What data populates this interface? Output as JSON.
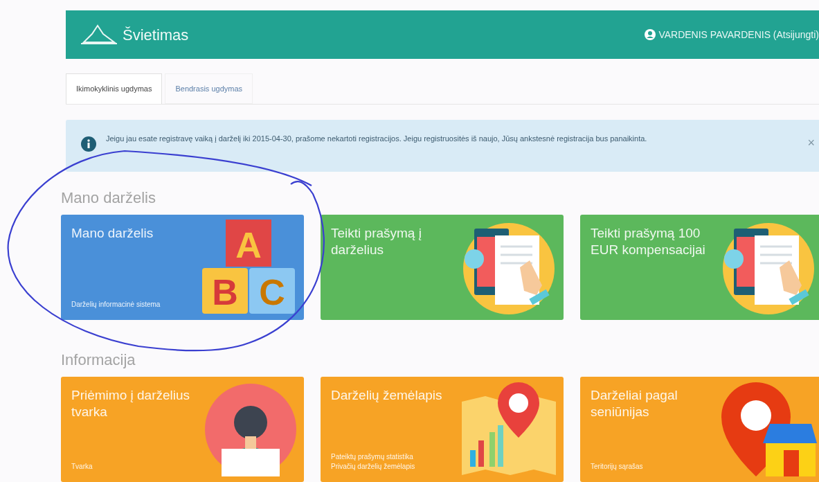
{
  "header": {
    "title": "Švietimas",
    "user": "VARDENIS PAVARDENIS (Atsijungti)"
  },
  "tabs": [
    {
      "label": "Ikimokyklinis ugdymas",
      "selected": true
    },
    {
      "label": "Bendrasis ugdymas",
      "selected": false
    }
  ],
  "alert": {
    "text": "Jeigu jau esate registravę vaiką į darželį iki 2015-04-30, prašome nekartoti registracijos. Jeigu registruositės iš naujo, Jūsų ankstesnė registracija bus panaikinta.",
    "close": "×"
  },
  "sections": [
    {
      "heading": "Mano darželis",
      "tiles": [
        {
          "title": "Mano darželis",
          "subtitle": [
            "Darželių informacinė sistema"
          ],
          "color": "#4a90d9",
          "kind": "abc",
          "blocks": [
            "A",
            "B",
            "C"
          ]
        },
        {
          "title": "Teikti prašymą į darželius",
          "color": "#5cb85c",
          "kind": "form"
        },
        {
          "title": "Teikti prašymą 100 EUR kompensacijai",
          "color": "#5cb85c",
          "kind": "form"
        }
      ]
    },
    {
      "heading": "Informacija",
      "tiles": [
        {
          "title": "Priėmimo į darželius tvarka",
          "subtitle": [
            "Tvarka"
          ],
          "color": "#f7a325",
          "kind": "person"
        },
        {
          "title": "Darželių žemėlapis",
          "subtitle": [
            "Pateiktų prašymų statistika",
            "Privačių darželių žemėlapis"
          ],
          "color": "#f7a325",
          "kind": "map"
        },
        {
          "title": "Darželiai pagal seniūnijas",
          "subtitle": [
            "Teritorijų sąrašas"
          ],
          "color": "#f7a325",
          "kind": "pin"
        }
      ]
    }
  ],
  "annotation": {
    "kind": "circle"
  }
}
